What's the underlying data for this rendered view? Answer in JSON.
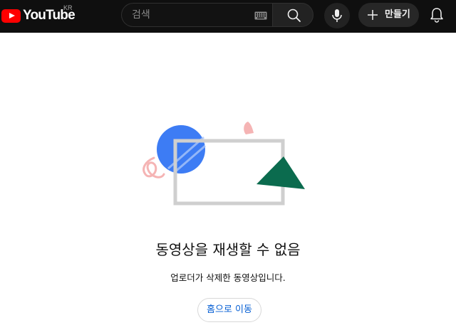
{
  "header": {
    "logo_text": "YouTube",
    "country_code": "KR",
    "search": {
      "placeholder": "검색",
      "value": ""
    },
    "create_label": "만들기",
    "icons": {
      "logo": "youtube-logo-icon",
      "keyboard": "keyboard-icon",
      "search": "search-icon",
      "mic": "mic-icon",
      "create": "plus-icon",
      "notifications": "bell-icon"
    },
    "colors": {
      "background": "#0f0f0f",
      "brand_red": "#ff0000"
    }
  },
  "main": {
    "title": "동영상을 재생할 수 없음",
    "description": "업로더가 삭제한 동영상입니다.",
    "home_button_label": "홈으로 이동",
    "colors": {
      "link_blue": "#065fd4",
      "circle_blue": "#3d7cf4",
      "triangle_green": "#0b6b4e",
      "accent_pink": "#f5b4b4",
      "frame_gray": "#cfcfcf"
    }
  }
}
